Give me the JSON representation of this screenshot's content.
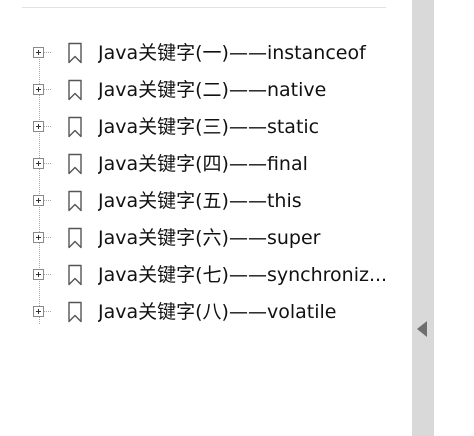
{
  "tree": {
    "items": [
      {
        "label": "Java关键字(一)——instanceof"
      },
      {
        "label": "Java关键字(二)——native"
      },
      {
        "label": "Java关键字(三)——static"
      },
      {
        "label": "Java关键字(四)——final"
      },
      {
        "label": "Java关键字(五)——this"
      },
      {
        "label": "Java关键字(六)——super"
      },
      {
        "label": "Java关键字(七)——synchroniz..."
      },
      {
        "label": "Java关键字(八)——volatile"
      }
    ]
  },
  "sidebar": {
    "collapse_icon": "triangle-left-icon",
    "strip_color": "#d9d9d9",
    "icon_color": "#6e6e6e"
  }
}
